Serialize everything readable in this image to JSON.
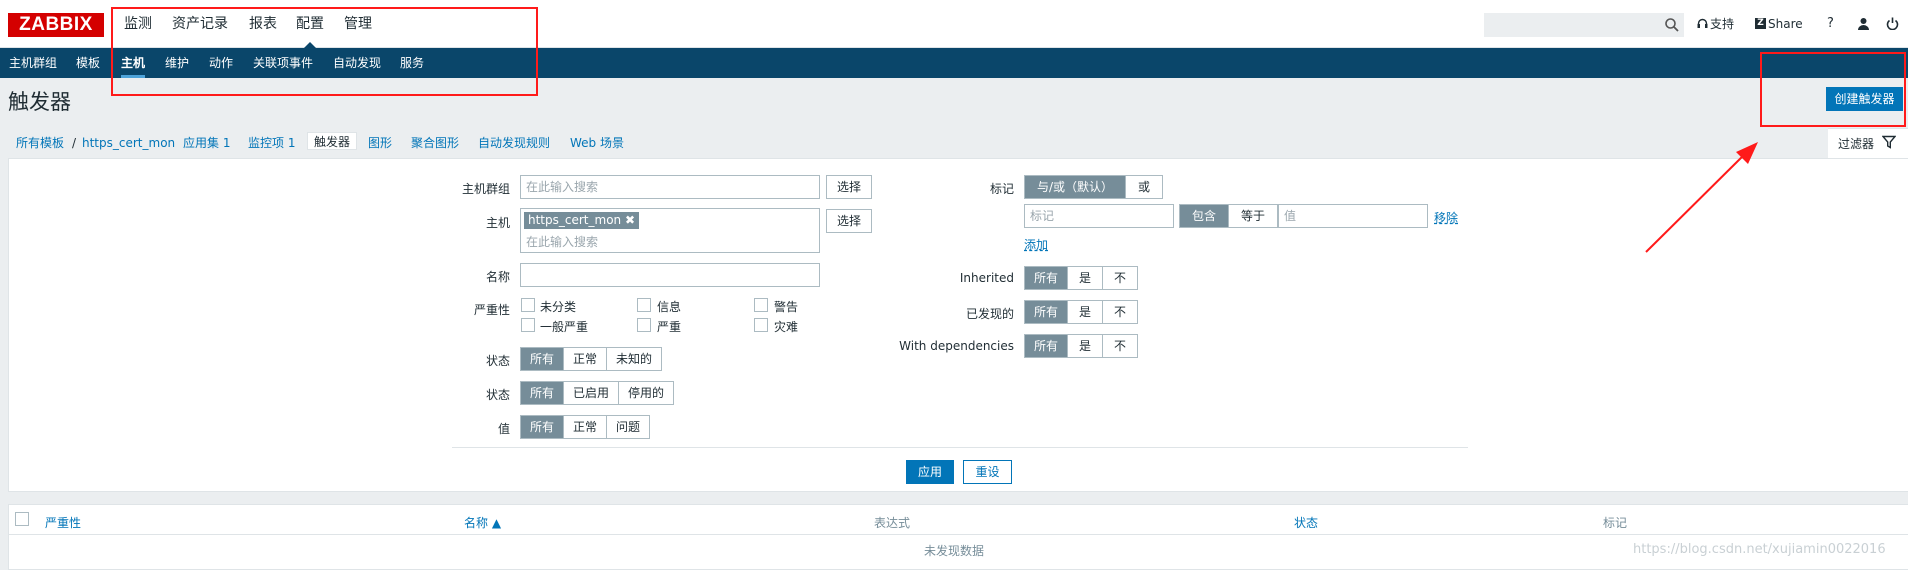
{
  "brand": {
    "logo": "ZABBIX"
  },
  "topmenu": [
    {
      "label": "监测"
    },
    {
      "label": "资产记录"
    },
    {
      "label": "报表"
    },
    {
      "label": "配置",
      "active": true
    },
    {
      "label": "管理"
    }
  ],
  "topright": {
    "support": "支持",
    "share": "Share",
    "help": "?"
  },
  "submenu": [
    {
      "label": "主机群组"
    },
    {
      "label": "模板"
    },
    {
      "label": "主机",
      "active": true
    },
    {
      "label": "维护"
    },
    {
      "label": "动作"
    },
    {
      "label": "关联项事件"
    },
    {
      "label": "自动发现"
    },
    {
      "label": "服务"
    }
  ],
  "page": {
    "title": "触发器",
    "create_button": "创建触发器"
  },
  "breadcrumb": {
    "all_templates": "所有模板",
    "separator": "/",
    "template": "https_cert_mon",
    "applications": "应用集 1",
    "items": "监控项 1",
    "triggers": "触发器",
    "graphs": "图形",
    "screens": "聚合图形",
    "discovery": "自动发现规则",
    "web": "Web 场景"
  },
  "filter": {
    "tab_label": "过滤器",
    "host_group_label": "主机群组",
    "host_group_placeholder": "在此输入搜索",
    "select_label": "选择",
    "host_label": "主机",
    "host_chip": "https_cert_mon",
    "host_placeholder": "在此输入搜索",
    "name_label": "名称",
    "severity_label": "严重性",
    "severities": [
      "未分类",
      "信息",
      "警告",
      "一般严重",
      "严重",
      "灾难"
    ],
    "state_label": "状态",
    "state_options": [
      "所有",
      "正常",
      "未知的"
    ],
    "status_label": "状态",
    "status_options": [
      "所有",
      "已启用",
      "停用的"
    ],
    "value_label": "值",
    "value_options": [
      "所有",
      "正常",
      "问题"
    ],
    "tags_label": "标记",
    "tags_mode": [
      "与/或（默认）",
      "或"
    ],
    "tag_placeholder": "标记",
    "tag_operators": [
      "包含",
      "等于"
    ],
    "tag_value_placeholder": "值",
    "remove_label": "移除",
    "add_label": "添加",
    "inherited_label": "Inherited",
    "discovered_label": "已发现的",
    "dependencies_label": "With dependencies",
    "tri_options": [
      "所有",
      "是",
      "不"
    ],
    "apply_label": "应用",
    "reset_label": "重设"
  },
  "table": {
    "columns": [
      "严重性",
      "名称 ▲",
      "表达式",
      "状态",
      "标记"
    ],
    "empty_message": "未发现数据"
  },
  "watermark": "https://blog.csdn.net/xujiamin0022016",
  "colors": {
    "brand_red": "#d40000",
    "nav_blue": "#0a466a",
    "accent": "#0275b8",
    "annotation": "#ff1a1a"
  }
}
